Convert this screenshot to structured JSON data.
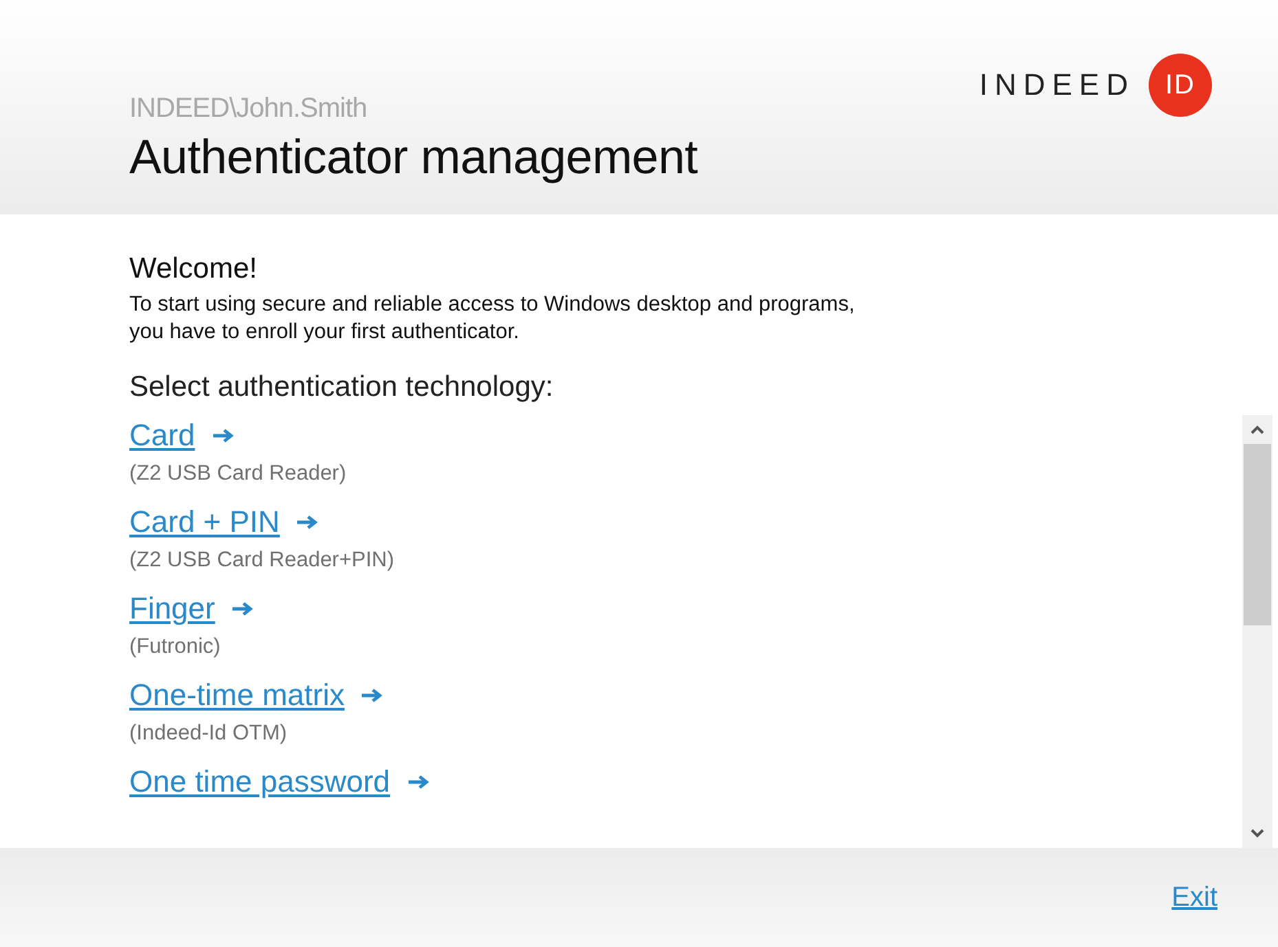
{
  "header": {
    "user": "INDEED\\John.Smith",
    "title": "Authenticator management",
    "logo": {
      "word": "INDEED",
      "badge": "ID"
    }
  },
  "welcome": {
    "heading": "Welcome!",
    "text": "To start using secure and reliable access to Windows desktop and programs,\nyou have to enroll your first authenticator."
  },
  "prompt": "Select authentication technology:",
  "technologies": [
    {
      "label": "Card",
      "device": "(Z2 USB Card Reader)"
    },
    {
      "label": "Card + PIN",
      "device": "(Z2 USB Card Reader+PIN)"
    },
    {
      "label": "Finger",
      "device": "(Futronic)"
    },
    {
      "label": "One-time matrix",
      "device": "(Indeed-Id OTM)"
    },
    {
      "label": "One time password"
    }
  ],
  "footer": {
    "exit": "Exit"
  }
}
